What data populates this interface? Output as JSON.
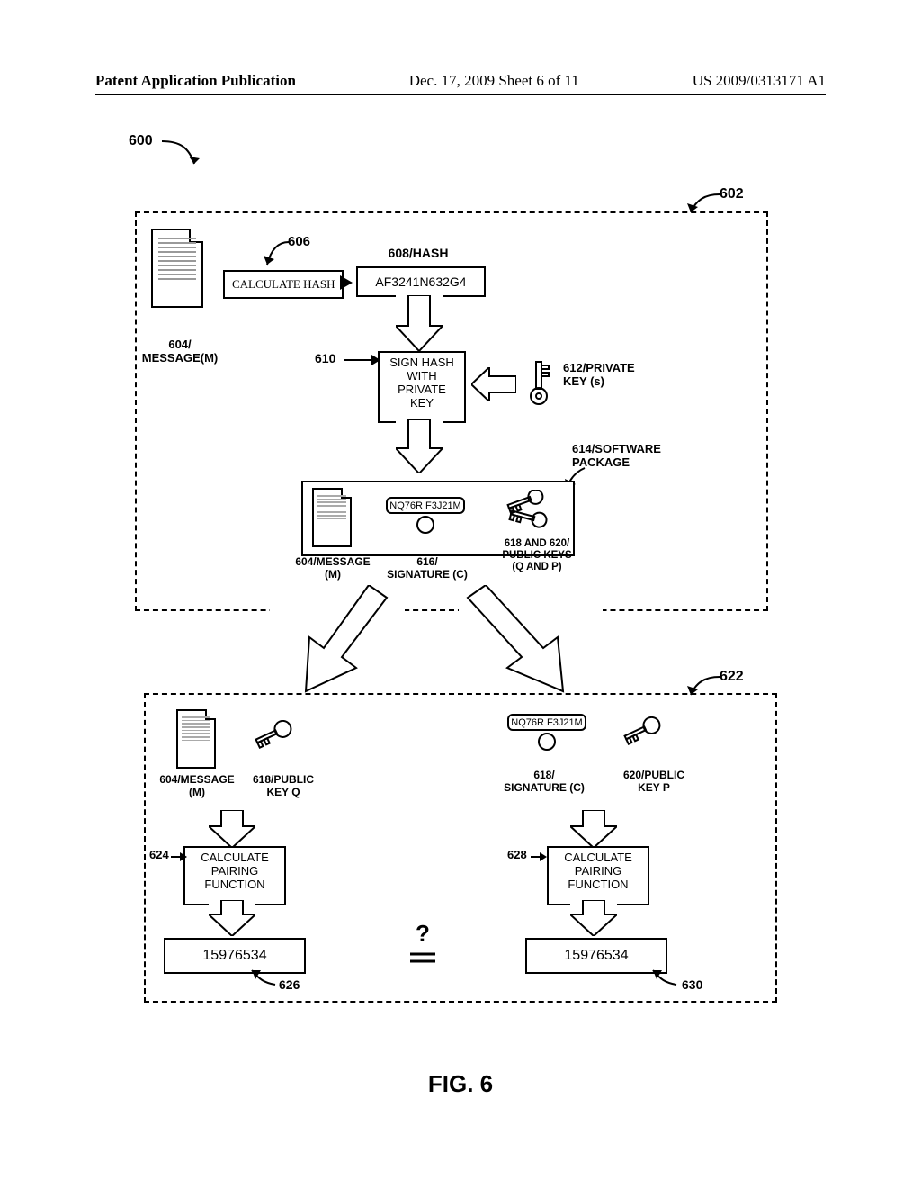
{
  "header": {
    "left": "Patent Application Publication",
    "mid": "Dec. 17, 2009  Sheet 6 of 11",
    "right": "US 2009/0313171 A1"
  },
  "figure_caption": "FIG. 6",
  "refs": {
    "r600": "600",
    "r602": "602",
    "r604_top": "604/\nMESSAGE(M)",
    "r604_mid": "604/MESSAGE\n(M)",
    "r604_bot": "604/MESSAGE\n(M)",
    "r606": "606",
    "r606_box": "CALCULATE HASH",
    "r608_label": "608/HASH",
    "r608_value": "AF3241N632G4",
    "r610": "610",
    "r610_box": "SIGN HASH\nWITH\nPRIVATE\nKEY",
    "r612": "612/PRIVATE\nKEY (s)",
    "r614": "614/SOFTWARE\nPACKAGE",
    "r616": "616/\nSIGNATURE (C)",
    "r616_value": "NQ76R   F3J21M",
    "r618_620": "618 AND 620/\nPUBLIC KEYS\n(Q AND P)",
    "r618_pub": "618/PUBLIC\nKEY Q",
    "r618_sig": "618/\nSIGNATURE (C)",
    "r618_sig_value": "NQ76R   F3J21M",
    "r620_pub": "620/PUBLIC\nKEY P",
    "r622": "622",
    "r624": "624",
    "r624_box": "CALCULATE\nPAIRING\nFUNCTION",
    "r628": "628",
    "r628_box": "CALCULATE\nPAIRING\nFUNCTION",
    "r626": "626",
    "r626_value": "15976534",
    "r630": "630",
    "r630_value": "15976534"
  }
}
